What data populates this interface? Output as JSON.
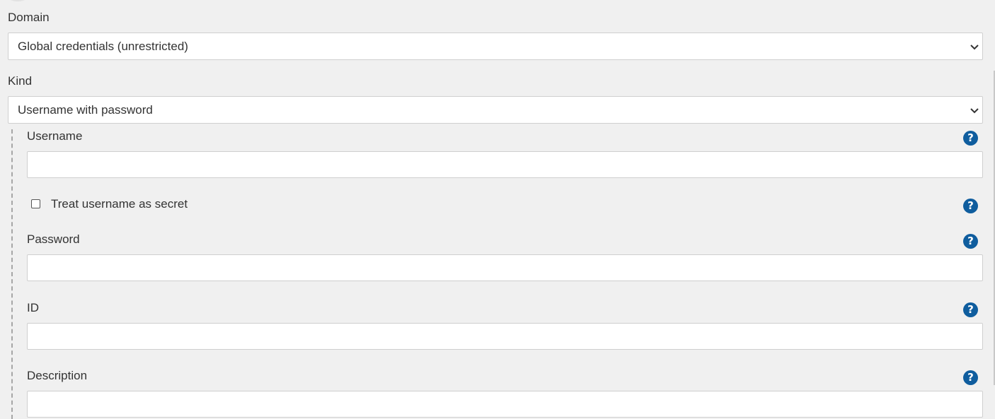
{
  "domain": {
    "label": "Domain",
    "selected": "Global credentials (unrestricted)"
  },
  "kind": {
    "label": "Kind",
    "selected": "Username with password"
  },
  "username": {
    "label": "Username",
    "value": ""
  },
  "treat_username_secret": {
    "label": "Treat username as secret",
    "checked": false
  },
  "password": {
    "label": "Password",
    "value": ""
  },
  "id_field": {
    "label": "ID",
    "value": ""
  },
  "description": {
    "label": "Description",
    "value": ""
  },
  "help_icon": {
    "glyph": "?",
    "color": "#0f5d9e"
  }
}
